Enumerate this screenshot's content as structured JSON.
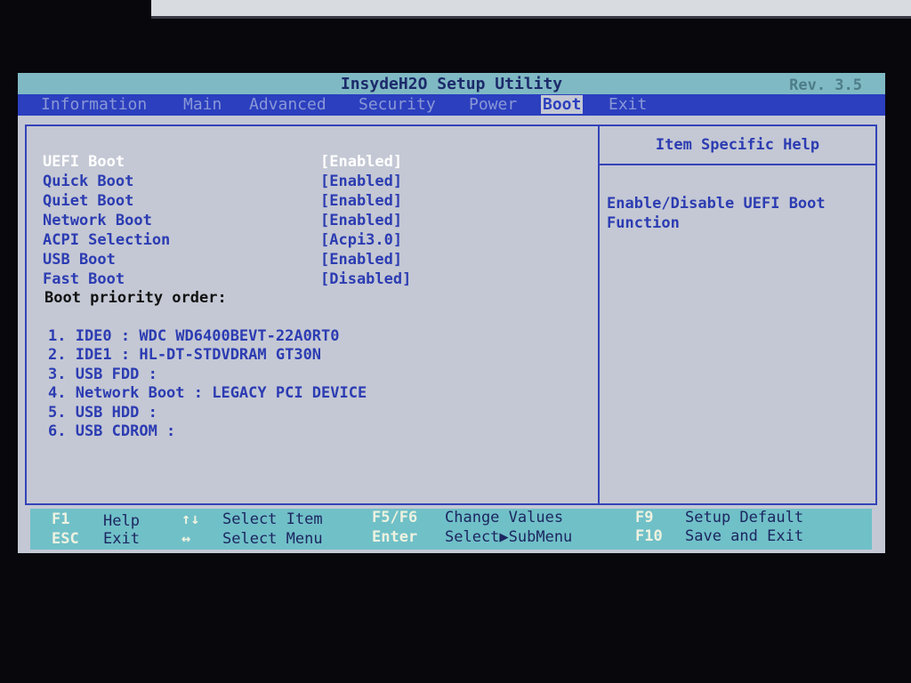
{
  "header": {
    "title": "InsydeH2O Setup Utility",
    "revision": "Rev. 3.5"
  },
  "tabs": [
    {
      "label": "Information"
    },
    {
      "label": "Main"
    },
    {
      "label": "Advanced"
    },
    {
      "label": "Security"
    },
    {
      "label": "Power"
    },
    {
      "label": "Boot",
      "active": true
    },
    {
      "label": "Exit"
    }
  ],
  "settings": [
    {
      "label": "UEFI Boot",
      "value": "[Enabled]"
    },
    {
      "label": "Quick Boot",
      "value": "[Enabled]"
    },
    {
      "label": "Quiet Boot",
      "value": "[Enabled]"
    },
    {
      "label": "Network Boot",
      "value": "[Enabled]"
    },
    {
      "label": "ACPI Selection",
      "value": "[Acpi3.0]"
    },
    {
      "label": "USB Boot",
      "value": "[Enabled]"
    },
    {
      "label": "Fast Boot",
      "value": "[Disabled]"
    }
  ],
  "boot_priority": {
    "heading": "Boot priority order:",
    "items": [
      "1. IDE0 : WDC WD6400BEVT-22A0RT0",
      "2. IDE1 : HL-DT-STDVDRAM GT30N",
      "3. USB FDD :",
      "4. Network Boot : LEGACY PCI DEVICE",
      "5. USB HDD :",
      "6. USB CDROM :"
    ]
  },
  "help": {
    "title": "Item Specific Help",
    "text": "Enable/Disable UEFI Boot Function"
  },
  "footer": [
    {
      "key": "F1",
      "desc": "Help"
    },
    {
      "key": "ESC",
      "desc": "Exit"
    },
    {
      "key": "↑↓",
      "desc": "Select Item"
    },
    {
      "key": "↔",
      "desc": "Select Menu"
    },
    {
      "key": "F5/F6",
      "desc": "Change Values"
    },
    {
      "key": "Enter",
      "desc": "Select▶SubMenu"
    },
    {
      "key": "F9",
      "desc": "Setup Default"
    },
    {
      "key": "F10",
      "desc": "Save and Exit"
    }
  ],
  "colors": {
    "menubar": "#2b3fbf",
    "panel": "#c4c8d4",
    "footer": "#70c0c8",
    "text": "#2c3cb2"
  }
}
